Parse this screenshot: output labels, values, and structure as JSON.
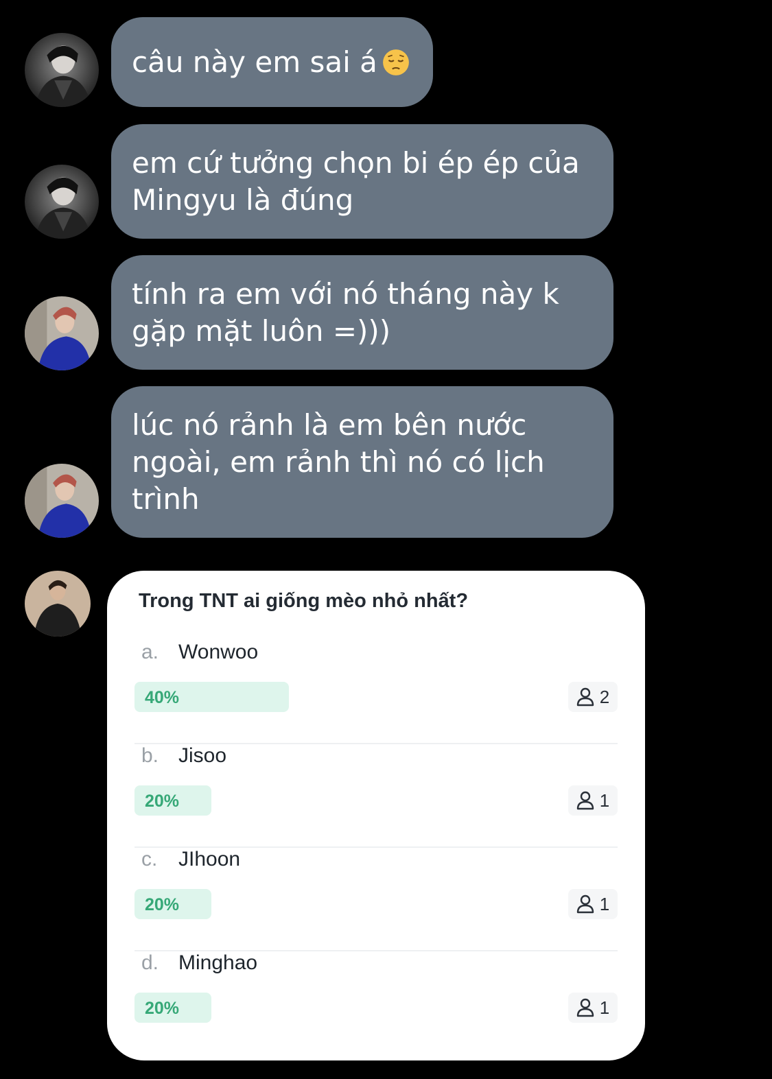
{
  "messages": [
    {
      "text": "câu này em sai á",
      "emoji": "pensive-face"
    },
    {
      "text": "em cứ tưởng chọn bi ép ép của\nMingyu là đúng"
    },
    {
      "text": "tính ra em với nó tháng này k\ngặp mặt luôn =)))"
    },
    {
      "text": "lúc nó rảnh là em bên nước\nngoài, em rảnh thì nó có lịch\ntrình"
    }
  ],
  "poll": {
    "question": "Trong TNT ai giống mèo nhỏ nhất?",
    "options": [
      {
        "letter": "a.",
        "name": "Wonwoo",
        "percent_label": "40%",
        "percent": 40,
        "votes": "2"
      },
      {
        "letter": "b.",
        "name": "Jisoo",
        "percent_label": "20%",
        "percent": 20,
        "votes": "1"
      },
      {
        "letter": "c.",
        "name": "JIhoon",
        "percent_label": "20%",
        "percent": 20,
        "votes": "1"
      },
      {
        "letter": "d.",
        "name": "Minghao",
        "percent_label": "20%",
        "percent": 20,
        "votes": "1"
      }
    ]
  },
  "colors": {
    "background": "#000000",
    "bubble": "#687583",
    "poll_bar": "#def5ec",
    "poll_percent": "#36a877"
  },
  "icons": {
    "vote_icon": "person-icon",
    "emoji": "pensive-face-emoji"
  }
}
